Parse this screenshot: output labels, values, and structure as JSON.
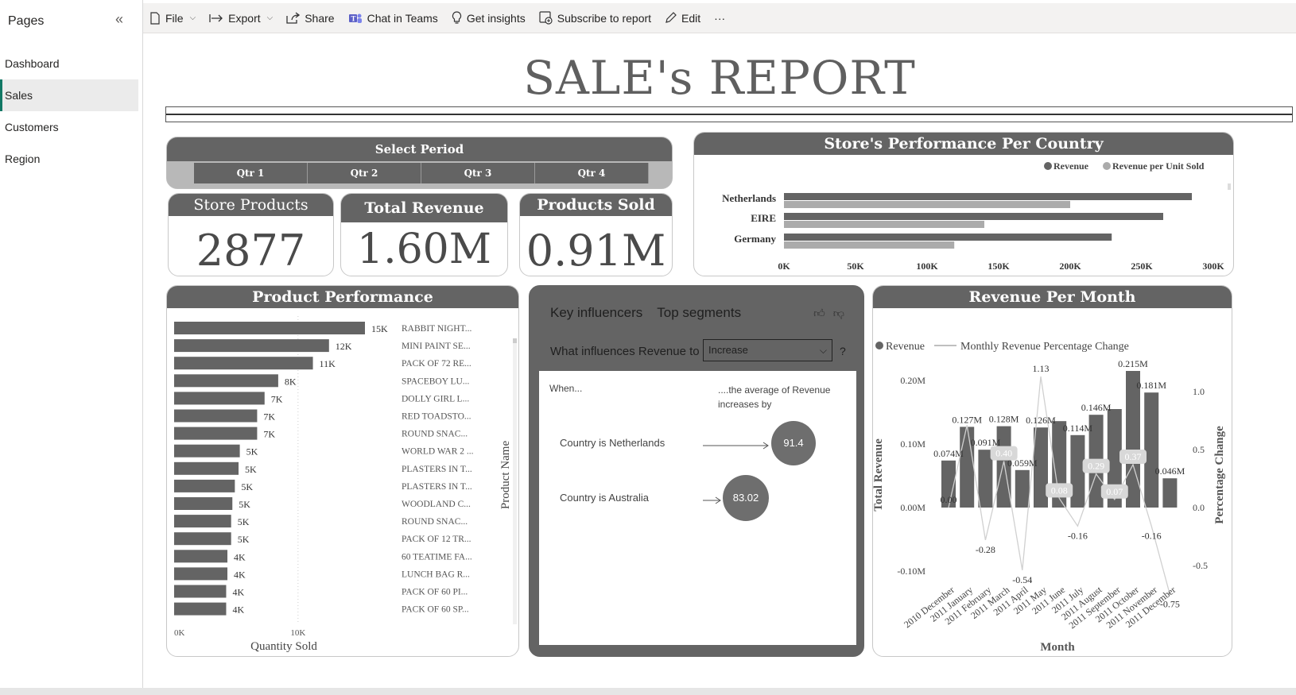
{
  "sidebar": {
    "title": "Pages",
    "items": [
      {
        "label": "Dashboard"
      },
      {
        "label": "Sales"
      },
      {
        "label": "Customers"
      },
      {
        "label": "Region"
      }
    ]
  },
  "toolbar": {
    "file": "File",
    "export": "Export",
    "share": "Share",
    "chat": "Chat in Teams",
    "insights": "Get insights",
    "subscribe": "Subscribe to report",
    "edit": "Edit",
    "more": "···"
  },
  "report": {
    "title": "SALE's REPORT"
  },
  "period": {
    "title": "Select Period",
    "quarters": [
      "Qtr 1",
      "Qtr 2",
      "Qtr 3",
      "Qtr 4"
    ]
  },
  "kpis": {
    "store_products": {
      "label": "Store Products",
      "value": "2877"
    },
    "total_revenue": {
      "label": "Total Revenue",
      "value": "1.60M"
    },
    "products_sold": {
      "label": "Products Sold",
      "value": "0.91M"
    }
  },
  "key_influencers": {
    "tab1": "Key influencers",
    "tab2": "Top segments",
    "question": "What influences Revenue to",
    "selected": "Increase",
    "help": "?",
    "when": "When...",
    "avg_text": "....the average of Revenue increases by",
    "rows": [
      {
        "label": "Country is Netherlands",
        "value": "91.4"
      },
      {
        "label": "Country is Australia",
        "value": "83.02"
      }
    ]
  },
  "chart_data": [
    {
      "type": "bar",
      "title": "Store's Performance Per Country",
      "orientation": "horizontal",
      "categories": [
        "Netherlands",
        "EIRE",
        "Germany"
      ],
      "series": [
        {
          "name": "Revenue",
          "values": [
            285000,
            265000,
            229000
          ],
          "color": "#646464"
        },
        {
          "name": "Revenue per Unit Sold",
          "values": [
            200000,
            140000,
            119000
          ],
          "color": "#ababab"
        }
      ],
      "x_ticks": [
        "0K",
        "50K",
        "100K",
        "150K",
        "200K",
        "250K",
        "300K"
      ],
      "xlim": [
        0,
        300000
      ],
      "legend": "top-right"
    },
    {
      "type": "bar",
      "title": "Product Performance",
      "orientation": "horizontal",
      "xlabel": "Quantity Sold",
      "ylabel": "Product Name",
      "x_ticks": [
        "0K",
        "10K"
      ],
      "xlim": [
        0,
        26500
      ],
      "categories": [
        "RABBIT NIGHT...",
        "MINI PAINT SE...",
        "PACK OF 72 RE...",
        "SPACEBOY LU...",
        "DOLLY GIRL L...",
        "RED TOADSTO...",
        "ROUND SNAC...",
        "WORLD WAR 2 ...",
        "PLASTERS IN T...",
        "PLASTERS IN T...",
        "WOODLAND C...",
        "ROUND SNAC...",
        "PACK OF 12 TR...",
        "60 TEATIME FA...",
        "LUNCH BAG R...",
        "PACK OF 60 PI...",
        "PACK OF 60 SP..."
      ],
      "values": [
        15400,
        12500,
        11200,
        8400,
        7300,
        6700,
        6700,
        5300,
        5200,
        4900,
        4700,
        4600,
        4600,
        4300,
        4300,
        4200,
        4200
      ],
      "labels": [
        "15K",
        "12K",
        "11K",
        "8K",
        "7K",
        "7K",
        "7K",
        "5K",
        "5K",
        "5K",
        "5K",
        "5K",
        "5K",
        "4K",
        "4K",
        "4K",
        "4K"
      ]
    },
    {
      "type": "bar",
      "title": "Revenue Per Month",
      "xlabel": "Month",
      "ylabel": "Total Revenue",
      "y2label": "Percentage Change",
      "categories": [
        "2010 December",
        "2011 January",
        "2011 February",
        "2011 March",
        "2011 April",
        "2011 May",
        "2011 June",
        "2011 July",
        "2011 August",
        "2011 September",
        "2011 October",
        "2011 November",
        "2011 December"
      ],
      "series": [
        {
          "name": "Revenue",
          "values": [
            0.074,
            0.127,
            0.091,
            0.128,
            0.059,
            0.126,
            0.136,
            0.114,
            0.146,
            0.155,
            0.215,
            0.181,
            0.046
          ],
          "labels": [
            "0.074M",
            "0.127M",
            "0.091M",
            "0.128M",
            "0.059M",
            "0.126M",
            "",
            "0.114M",
            "0.146M",
            "",
            "0.215M",
            "0.181M",
            "0.046M"
          ]
        },
        {
          "name": "Monthly Revenue Percentage Change",
          "type": "line",
          "values": [
            0.0,
            0.71,
            -0.28,
            0.4,
            -0.54,
            1.13,
            0.08,
            -0.16,
            0.29,
            0.07,
            0.37,
            -0.16,
            -0.75
          ],
          "labels": [
            "0.00",
            "",
            "-0.28",
            "0.40",
            "-0.54",
            "1.13",
            "0.08",
            "-0.16",
            "0.29",
            "0.07",
            "0.37",
            "-0.16",
            "-0.75"
          ]
        }
      ],
      "y_ticks": [
        "0.20M",
        "0.10M",
        "0.00M",
        "-0.10M"
      ],
      "y2_ticks": [
        "1.0",
        "0.5",
        "0.0",
        "-0.5"
      ],
      "ylim": [
        -0.1,
        0.2
      ],
      "y2lim": [
        -1.0,
        1.0
      ],
      "legend": "top-left"
    }
  ]
}
